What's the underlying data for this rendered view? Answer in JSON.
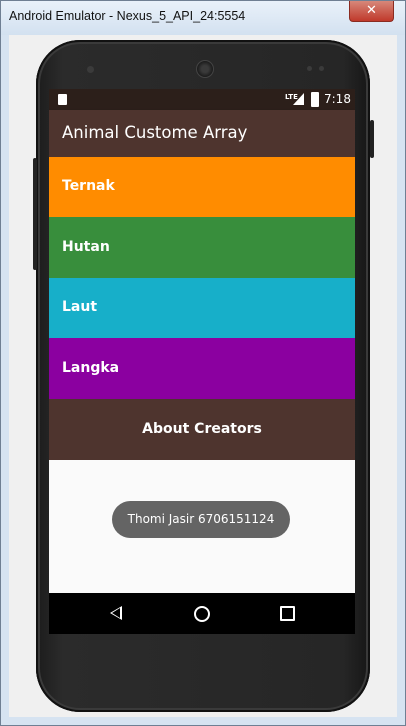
{
  "window": {
    "title": "Android Emulator - Nexus_5_API_24:5554",
    "close_glyph": "✕"
  },
  "status_bar": {
    "network": "LTE",
    "time": "7:18"
  },
  "app": {
    "title": "Animal Custome Array",
    "categories": [
      {
        "label": "Ternak",
        "color": "#ff8c00"
      },
      {
        "label": "Hutan",
        "color": "#388e3c"
      },
      {
        "label": "Laut",
        "color": "#17afc9"
      },
      {
        "label": "Langka",
        "color": "#8b00a0"
      }
    ],
    "about_label": "About Creators",
    "toast": "Thomi Jasir 6706151124"
  },
  "colors": {
    "appbar": "#4e342e",
    "statusbar": "#2c1f1a"
  }
}
